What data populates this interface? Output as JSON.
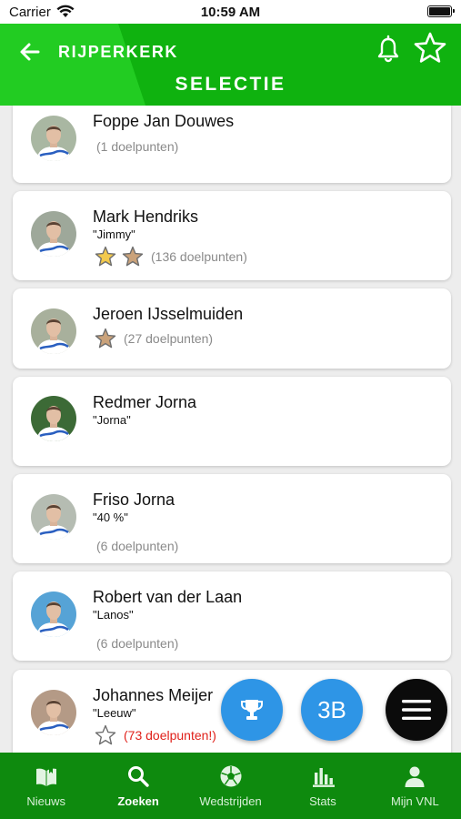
{
  "status_bar": {
    "carrier": "Carrier",
    "time": "10:59 AM"
  },
  "header": {
    "club": "RIJPERKERK",
    "title": "SELECTIE"
  },
  "colors": {
    "header_green": "#17c017",
    "tabbar_green": "#0e8a0e",
    "fab_blue": "#2e95e6",
    "hot_red": "#e0201a",
    "star_gold": "#f2c94c",
    "star_bronze": "#caa27a"
  },
  "players": [
    {
      "name": "Foppe Jan Douwes",
      "nickname": "",
      "stars": [],
      "goals": "(1 doelpunten)",
      "goals_highlight": false
    },
    {
      "name": "Mark Hendriks",
      "nickname": "\"Jimmy\"",
      "stars": [
        "gold",
        "bronze"
      ],
      "goals": "(136 doelpunten)",
      "goals_highlight": false
    },
    {
      "name": "Jeroen IJsselmuiden",
      "nickname": "",
      "stars": [
        "bronze"
      ],
      "goals": "(27 doelpunten)",
      "goals_highlight": false
    },
    {
      "name": "Redmer Jorna",
      "nickname": "\"Jorna\"",
      "stars": [],
      "goals": "",
      "goals_highlight": false
    },
    {
      "name": "Friso Jorna",
      "nickname": "\"40 %\"",
      "stars": [],
      "goals": "(6 doelpunten)",
      "goals_highlight": false
    },
    {
      "name": "Robert van der Laan",
      "nickname": "\"Lanos\"",
      "stars": [],
      "goals": "(6 doelpunten)",
      "goals_highlight": false
    },
    {
      "name": "Johannes Meijer",
      "nickname": "\"Leeuw\"",
      "stars": [
        "outline"
      ],
      "goals": "(73 doelpunten!)",
      "goals_highlight": true
    }
  ],
  "fabs": {
    "trophy_icon": "trophy-icon",
    "score_label": "3B",
    "menu_icon": "hamburger-menu-icon"
  },
  "tabs": [
    {
      "label": "Nieuws",
      "icon": "book-icon",
      "active": false
    },
    {
      "label": "Zoeken",
      "icon": "search-icon",
      "active": true
    },
    {
      "label": "Wedstrijden",
      "icon": "soccer-ball-icon",
      "active": false
    },
    {
      "label": "Stats",
      "icon": "bar-chart-icon",
      "active": false
    },
    {
      "label": "Mijn VNL",
      "icon": "person-icon",
      "active": false
    }
  ]
}
